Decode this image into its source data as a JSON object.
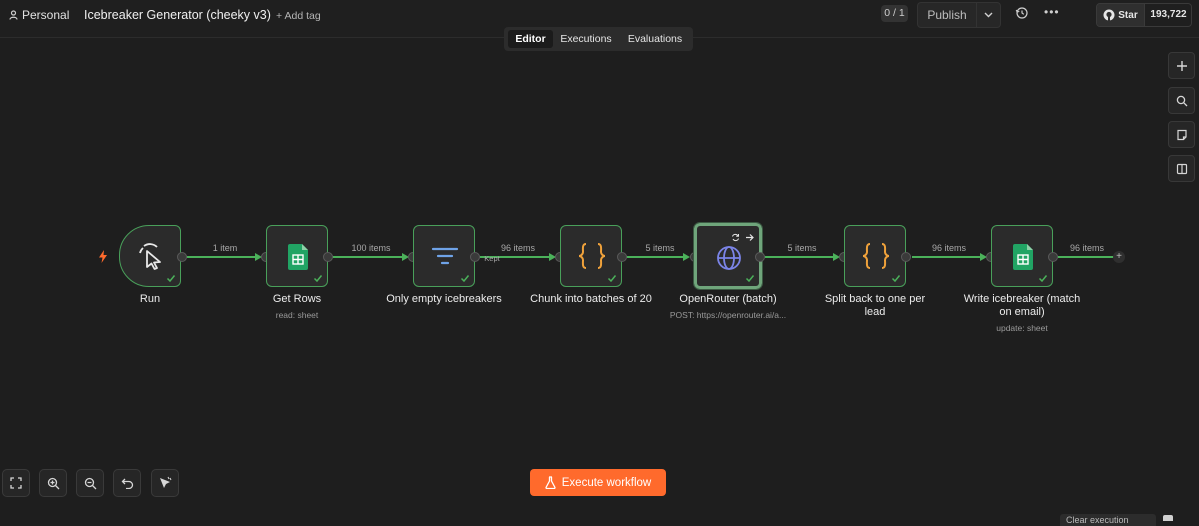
{
  "header": {
    "project": "Personal",
    "workflow_title": "Icebreaker Generator (cheeky v3)",
    "add_tag": "+ Add tag",
    "counter": "0 / 1",
    "publish": "Publish",
    "github_star": "Star",
    "github_count": "193,722"
  },
  "tabs": [
    {
      "label": "Editor",
      "active": true
    },
    {
      "label": "Executions",
      "active": false
    },
    {
      "label": "Evaluations",
      "active": false
    }
  ],
  "side_toolbar": [
    "plus-icon",
    "search-icon",
    "sticky-note-icon",
    "panel-icon"
  ],
  "nodes": [
    {
      "title": "Run",
      "subtitle": "",
      "icon": "cursor-click-icon"
    },
    {
      "title": "Get Rows",
      "subtitle": "read: sheet",
      "icon": "google-sheets-icon"
    },
    {
      "title": "Only empty icebreakers",
      "subtitle": "",
      "icon": "filter-icon"
    },
    {
      "title": "Chunk into batches of 20",
      "subtitle": "",
      "icon": "code-braces-icon"
    },
    {
      "title": "OpenRouter (batch)",
      "subtitle": "POST: https://openrouter.ai/a...",
      "icon": "globe-icon"
    },
    {
      "title": "Split back to one per",
      "title2": "lead",
      "subtitle": "",
      "icon": "code-braces-icon"
    },
    {
      "title": "Write icebreaker (match",
      "title2": "on email)",
      "subtitle": "update: sheet",
      "icon": "google-sheets-icon"
    }
  ],
  "edges": [
    {
      "label": "1 item"
    },
    {
      "label": "100 items"
    },
    {
      "label": "96 items",
      "branch": "Kept"
    },
    {
      "label": "5 items"
    },
    {
      "label": "5 items"
    },
    {
      "label": "96 items"
    },
    {
      "label": "96 items"
    }
  ],
  "bottom_toolbar": [
    "fit-view-icon",
    "zoom-in-icon",
    "zoom-out-icon",
    "undo-icon",
    "tidy-up-icon"
  ],
  "execute_button": "Execute workflow",
  "clear_execution": "Clear execution",
  "colors": {
    "accent": "#ff6a2c",
    "edge": "#4bb15a",
    "sheets": "#21a464",
    "brace": "#f0a23b",
    "globe": "#7b84e8"
  }
}
